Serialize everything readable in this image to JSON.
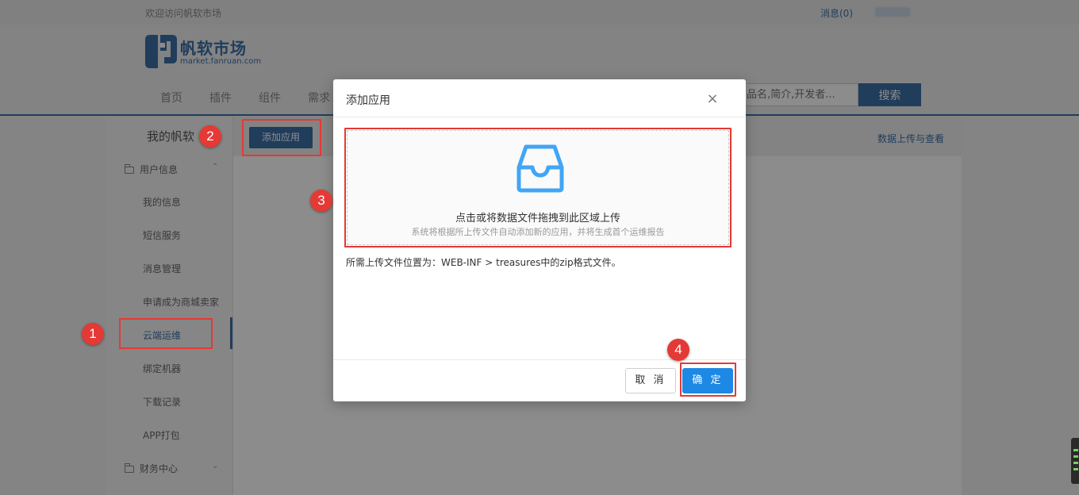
{
  "topbar": {
    "welcome": "欢迎访问帆软市场",
    "messages": "消息(0)"
  },
  "logo": {
    "name": "帆软市场",
    "domain": "market.fanruan.com"
  },
  "nav": {
    "items": [
      "首页",
      "插件",
      "组件",
      "需求"
    ]
  },
  "search": {
    "placeholder": "品名,简介,开发者...",
    "button": "搜索"
  },
  "sidebar": {
    "title": "我的帆软",
    "group_user": "用户信息",
    "items": [
      "我的信息",
      "短信服务",
      "消息管理",
      "申请成为商城卖家",
      "云端运维",
      "绑定机器",
      "下载记录",
      "APP打包"
    ],
    "active_index": 4,
    "group_finance": "财务中心"
  },
  "content": {
    "add_app_button": "添加应用",
    "upload_link": "数据上传与查看"
  },
  "modal": {
    "title": "添加应用",
    "close": "×",
    "drop_main": "点击或将数据文件拖拽到此区域上传",
    "drop_sub": "系统将根据所上传文件自动添加新的应用，并将生成首个运维报告",
    "hint": "所需上传文件位置为：WEB-INF > treasures中的zip格式文件。",
    "cancel": "取 消",
    "ok": "确 定"
  },
  "annotations": {
    "badges": [
      "1",
      "2",
      "3",
      "4"
    ],
    "color": "#e53935"
  },
  "colors": {
    "brand": "#3d6fa8",
    "primary_button": "#1e88e5",
    "icon": "#42a5f5"
  }
}
